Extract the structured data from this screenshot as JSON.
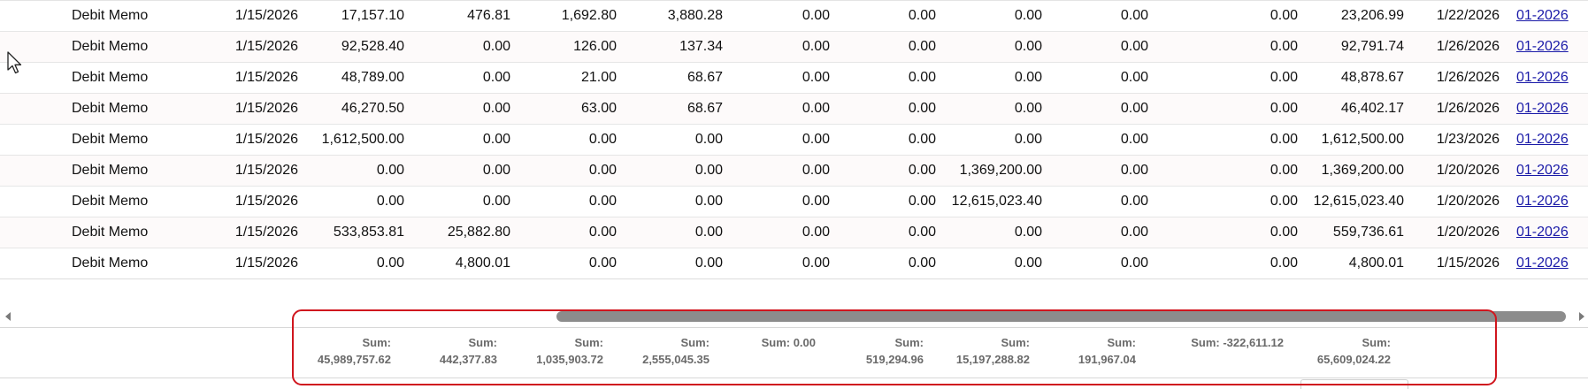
{
  "rows": [
    {
      "type": "Debit Memo",
      "date": "1/15/2026",
      "n": [
        "17,157.10",
        "476.81",
        "1,692.80",
        "3,880.28",
        "0.00",
        "0.00",
        "0.00",
        "0.00",
        "0.00",
        "23,206.99"
      ],
      "due": "1/22/2026",
      "period": "01-2026"
    },
    {
      "type": "Debit Memo",
      "date": "1/15/2026",
      "n": [
        "92,528.40",
        "0.00",
        "126.00",
        "137.34",
        "0.00",
        "0.00",
        "0.00",
        "0.00",
        "0.00",
        "92,791.74"
      ],
      "due": "1/26/2026",
      "period": "01-2026"
    },
    {
      "type": "Debit Memo",
      "date": "1/15/2026",
      "n": [
        "48,789.00",
        "0.00",
        "21.00",
        "68.67",
        "0.00",
        "0.00",
        "0.00",
        "0.00",
        "0.00",
        "48,878.67"
      ],
      "due": "1/26/2026",
      "period": "01-2026"
    },
    {
      "type": "Debit Memo",
      "date": "1/15/2026",
      "n": [
        "46,270.50",
        "0.00",
        "63.00",
        "68.67",
        "0.00",
        "0.00",
        "0.00",
        "0.00",
        "0.00",
        "46,402.17"
      ],
      "due": "1/26/2026",
      "period": "01-2026"
    },
    {
      "type": "Debit Memo",
      "date": "1/15/2026",
      "n": [
        "1,612,500.00",
        "0.00",
        "0.00",
        "0.00",
        "0.00",
        "0.00",
        "0.00",
        "0.00",
        "0.00",
        "1,612,500.00"
      ],
      "due": "1/23/2026",
      "period": "01-2026"
    },
    {
      "type": "Debit Memo",
      "date": "1/15/2026",
      "n": [
        "0.00",
        "0.00",
        "0.00",
        "0.00",
        "0.00",
        "0.00",
        "1,369,200.00",
        "0.00",
        "0.00",
        "1,369,200.00"
      ],
      "due": "1/20/2026",
      "period": "01-2026"
    },
    {
      "type": "Debit Memo",
      "date": "1/15/2026",
      "n": [
        "0.00",
        "0.00",
        "0.00",
        "0.00",
        "0.00",
        "0.00",
        "12,615,023.40",
        "0.00",
        "0.00",
        "12,615,023.40"
      ],
      "due": "1/20/2026",
      "period": "01-2026"
    },
    {
      "type": "Debit Memo",
      "date": "1/15/2026",
      "n": [
        "533,853.81",
        "25,882.80",
        "0.00",
        "0.00",
        "0.00",
        "0.00",
        "0.00",
        "0.00",
        "0.00",
        "559,736.61"
      ],
      "due": "1/20/2026",
      "period": "01-2026"
    },
    {
      "type": "Debit Memo",
      "date": "1/15/2026",
      "n": [
        "0.00",
        "4,800.01",
        "0.00",
        "0.00",
        "0.00",
        "0.00",
        "0.00",
        "0.00",
        "0.00",
        "4,800.01"
      ],
      "due": "1/15/2026",
      "period": "01-2026"
    }
  ],
  "sums": [
    {
      "l1": "Sum:",
      "l2": "45,989,757.62"
    },
    {
      "l1": "Sum:",
      "l2": "442,377.83"
    },
    {
      "l1": "Sum:",
      "l2": "1,035,903.72"
    },
    {
      "l1": "Sum:",
      "l2": "2,555,045.35"
    },
    {
      "l1": "Sum: 0.00",
      "l2": ""
    },
    {
      "l1": "Sum:",
      "l2": "519,294.96"
    },
    {
      "l1": "Sum:",
      "l2": "15,197,288.82"
    },
    {
      "l1": "Sum:",
      "l2": "191,967.04"
    },
    {
      "l1": "Sum: -322,611.12",
      "l2": ""
    },
    {
      "l1": "Sum:",
      "l2": "65,609,024.22"
    }
  ],
  "colors": {
    "link": "#1a1aa8",
    "highlight": "#d0161e",
    "scroll_thumb": "#8c8c8c"
  },
  "icons": [
    "mouse-cursor-icon",
    "scroll-left-arrow-icon",
    "scroll-right-arrow-icon"
  ]
}
